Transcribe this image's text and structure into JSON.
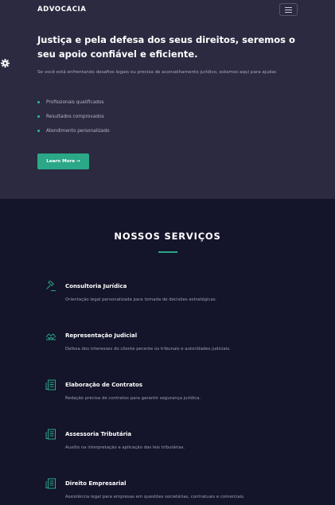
{
  "header": {
    "brand": "ADVOCACIA",
    "menu_icon": "hamburger-menu-icon"
  },
  "side_toolbar": {
    "icons": [
      "moon-icon",
      "gear-icon"
    ]
  },
  "hero": {
    "title": "Justiça e pela defesa dos seus direitos, seremos o seu apoio confiável e eficiente.",
    "description": "Se você está enfrentando desafios legais ou precisa de aconselhamento jurídico, estamos aqui para ajudar.",
    "features": [
      {
        "label": "Profissionais qualificados"
      },
      {
        "label": "Resultados comprovados"
      },
      {
        "label": "Atendimento personalizado"
      }
    ],
    "cta_label": "Learn More →"
  },
  "services": {
    "title": "NOSSOS SERVIÇOS",
    "items": [
      {
        "icon": "gavel-icon",
        "name": "Consultoria Jurídica",
        "description": "Orientação legal personalizada para tomada de decisões estratégicas."
      },
      {
        "icon": "handshake-icon",
        "name": "Representação Judicial",
        "description": "Defesa dos interesses do cliente perante os tribunais e autoridades judiciais."
      },
      {
        "icon": "document-icon",
        "name": "Elaboração de Contratos",
        "description": "Redação precisa de contratos para garantir segurança jurídica."
      },
      {
        "icon": "document-icon",
        "name": "Assessoria Tributária",
        "description": "Auxílio na interpretação e aplicação das leis tributárias."
      },
      {
        "icon": "document-icon",
        "name": "Direito Empresarial",
        "description": "Assistência legal para empresas em questões societárias, contratuais e comerciais."
      }
    ]
  },
  "colors": {
    "hero_bg": "#2b2a40",
    "page_bg": "#14142a",
    "accent": "#2aa888"
  }
}
